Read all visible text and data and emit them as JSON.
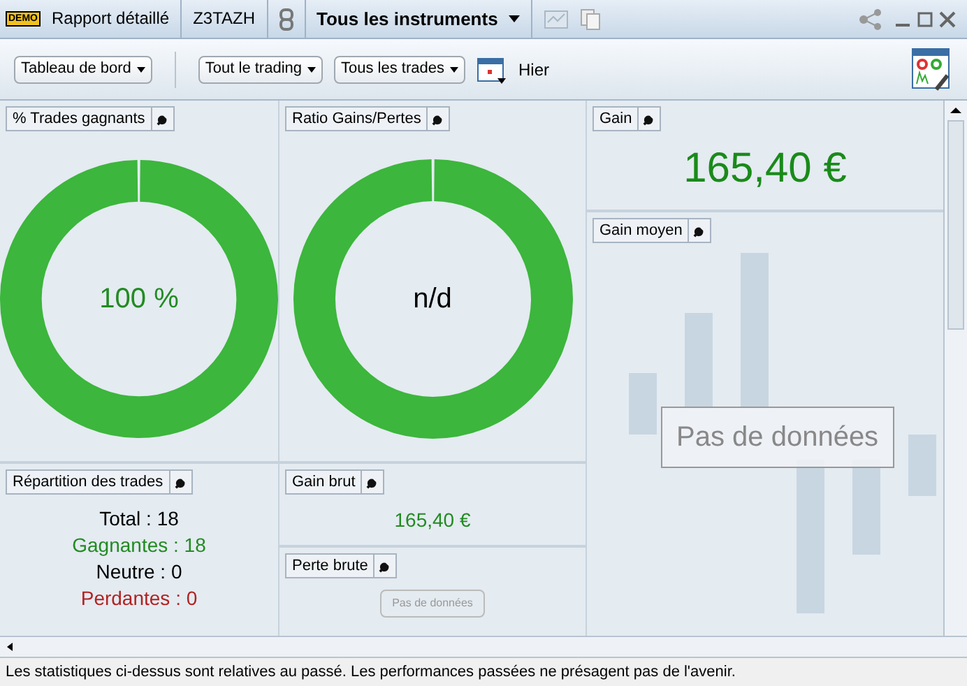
{
  "title_bar": {
    "badge": "DEMO",
    "report": "Rapport détaillé",
    "account": "Z3TAZH",
    "instrument": "Tous les instruments"
  },
  "toolbar": {
    "dashboard": "Tableau de bord",
    "trading": "Tout le trading",
    "trades": "Tous les trades",
    "date": "Hier"
  },
  "panels": {
    "win_rate": {
      "title": "% Trades gagnants",
      "value": "100 %",
      "color": "#228b22"
    },
    "ratio": {
      "title": "Ratio Gains/Pertes",
      "value": "n/d",
      "color": "#000000"
    },
    "gain": {
      "title": "Gain",
      "value": "165,40 €"
    },
    "avg_gain": {
      "title": "Gain moyen",
      "empty": "Pas de données"
    },
    "distribution": {
      "title": "Répartition des trades",
      "rows": [
        {
          "text": "Total : 18",
          "color": "#000000"
        },
        {
          "text": "Gagnantes : 18",
          "color": "#228b22"
        },
        {
          "text": "Neutre : 0",
          "color": "#000000"
        },
        {
          "text": "Perdantes : 0",
          "color": "#b22222"
        }
      ]
    },
    "gross_gain": {
      "title": "Gain brut",
      "value": "165,40 €"
    },
    "gross_loss": {
      "title": "Perte brute",
      "empty": "Pas de données"
    }
  },
  "status_bar": "Les statistiques ci-dessus sont relatives au passé. Les performances passées ne présagent pas de l'avenir."
}
